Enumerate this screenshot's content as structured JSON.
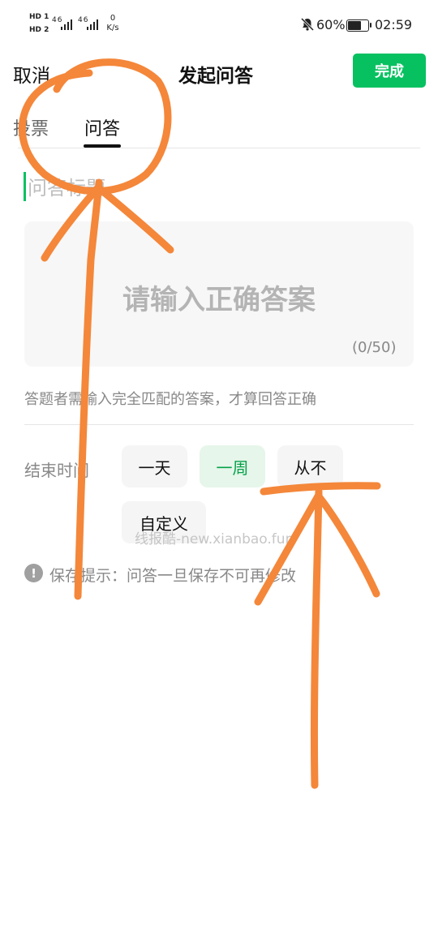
{
  "status_bar": {
    "hd1": "HD 1",
    "hd2": "HD 2",
    "signal1": "46",
    "signal2": "46",
    "speed_value": "0",
    "speed_unit": "K/s",
    "battery": "60%",
    "time": "02:59",
    "icons": [
      "mute-bell-icon",
      "battery-icon",
      "signal-icon"
    ]
  },
  "nav": {
    "cancel": "取消",
    "title": "发起问答",
    "done": "完成"
  },
  "tabs": [
    {
      "label": "投票",
      "active": false
    },
    {
      "label": "问答",
      "active": true
    }
  ],
  "question": {
    "title_placeholder": "问答标题"
  },
  "answer": {
    "placeholder": "请输入正确答案",
    "counter": "(0/50)"
  },
  "hint": "答题者需输入完全匹配的答案，才算回答正确",
  "end_time": {
    "label": "结束时间",
    "options": [
      {
        "label": "一天",
        "selected": false
      },
      {
        "label": "一周",
        "selected": true
      },
      {
        "label": "从不",
        "selected": false
      },
      {
        "label": "自定义",
        "selected": false
      }
    ]
  },
  "save_note": "保存提示：问答一旦保存不可再修改",
  "watermark": "线报酷-new.xianbao.fun",
  "colors": {
    "accent": "#07c160",
    "annotation": "#f4873a"
  }
}
